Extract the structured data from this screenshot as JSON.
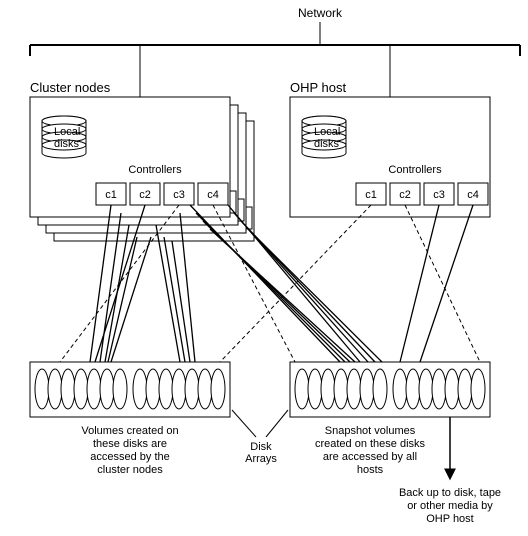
{
  "labels": {
    "network": "Network",
    "cluster_title": "Cluster nodes",
    "ohp_title": "OHP host",
    "local_disks": "Local disks",
    "controllers": "Controllers",
    "c1": "c1",
    "c2": "c2",
    "c3": "c3",
    "c4": "c4",
    "disk_arrays": "Disk Arrays",
    "left_caption_1": "Volumes created on",
    "left_caption_2": "these disks are",
    "left_caption_3": "accessed by the",
    "left_caption_4": "cluster nodes",
    "right_caption_1": "Snapshot volumes",
    "right_caption_2": "created on these disks",
    "right_caption_3": "are accessed by all",
    "right_caption_4": "hosts",
    "backup_1": "Back up to disk, tape",
    "backup_2": "or other media by",
    "backup_3": "OHP host"
  }
}
